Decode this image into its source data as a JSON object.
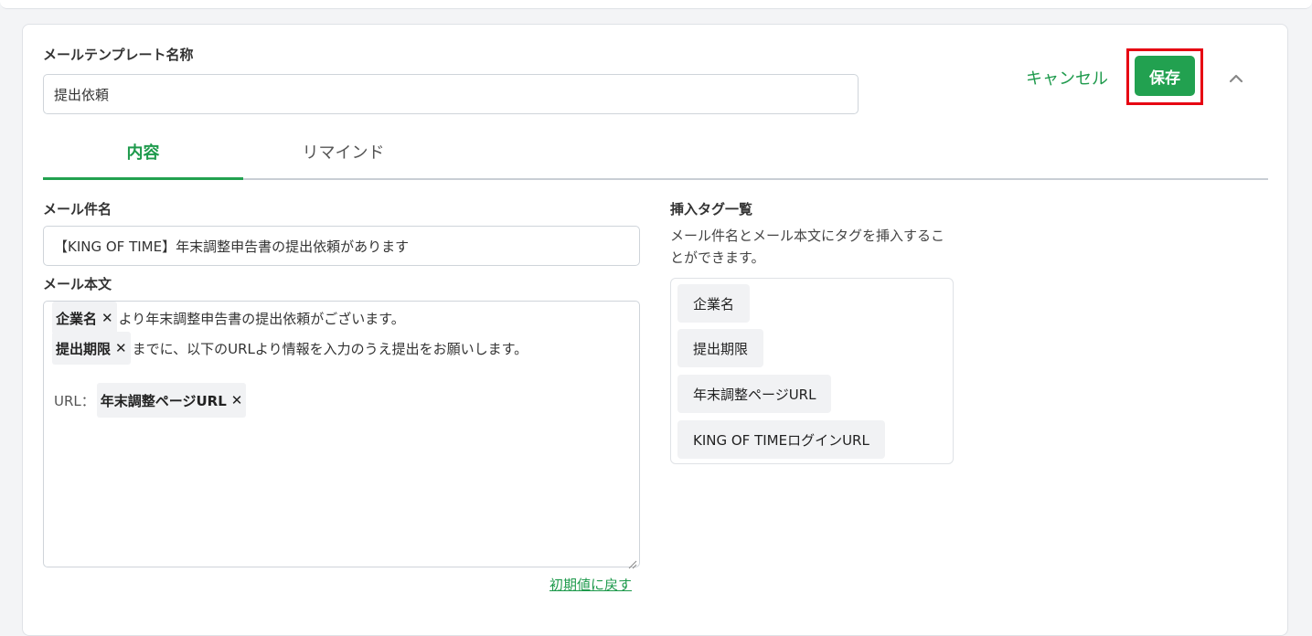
{
  "template": {
    "name_label": "メールテンプレート名称",
    "name_value": "提出依頼"
  },
  "actions": {
    "cancel_label": "キャンセル",
    "save_label": "保存"
  },
  "tabs": [
    {
      "label": "内容",
      "active": true
    },
    {
      "label": "リマインド",
      "active": false
    }
  ],
  "subject": {
    "label": "メール件名",
    "value": "【KING OF TIME】年末調整申告書の提出依頼があります"
  },
  "body": {
    "label": "メール本文",
    "line1_tag": "企業名",
    "line1_text": "より年末調整申告書の提出依頼がございます。",
    "line2_tag": "提出期限",
    "line2_text": "までに、以下のURLより情報を入力のうえ提出をお願いします。",
    "line3_prefix": "URL：",
    "line3_tag": "年末調整ページURL",
    "remove_glyph": "✕",
    "reset_label": "初期値に戻す"
  },
  "insert_tags": {
    "heading": "挿入タグ一覧",
    "description": "メール件名とメール本文にタグを挿入することができます。",
    "items": [
      "企業名",
      "提出期限",
      "年末調整ページURL",
      "KING OF TIMEログインURL"
    ]
  },
  "colors": {
    "accent": "#22a150",
    "accent_text": "#1e9a4c",
    "highlight": "#e60012"
  },
  "icons": {
    "collapse": "chevron-up-icon",
    "remove": "close-icon"
  }
}
